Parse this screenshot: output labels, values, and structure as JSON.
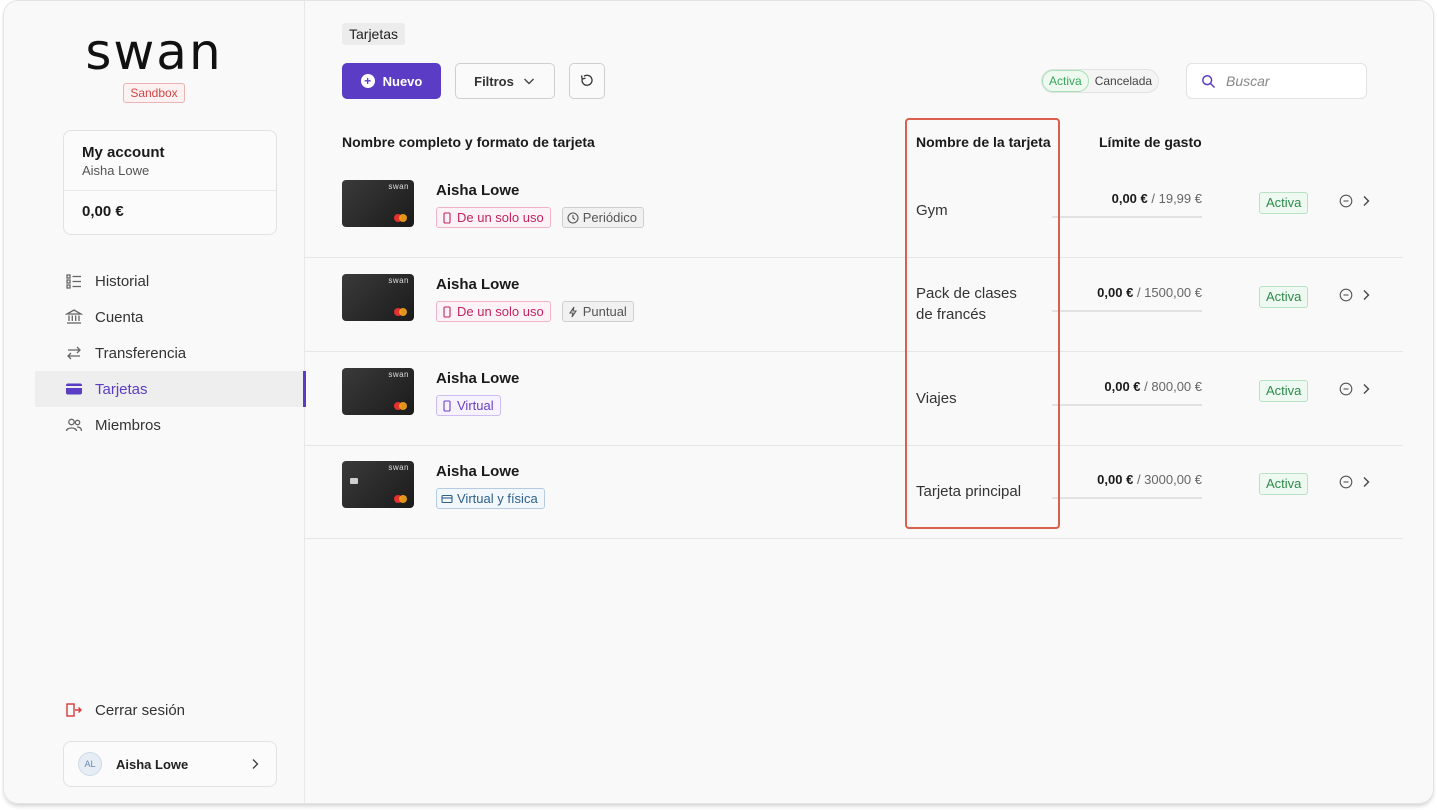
{
  "sidebar": {
    "logo": "swan",
    "env_badge": "Sandbox",
    "account": {
      "title": "My account",
      "owner": "Aisha Lowe",
      "balance": "0,00 €"
    },
    "nav": [
      {
        "label": "Historial",
        "icon": "list-icon"
      },
      {
        "label": "Cuenta",
        "icon": "bank-icon"
      },
      {
        "label": "Transferencia",
        "icon": "transfer-icon"
      },
      {
        "label": "Tarjetas",
        "icon": "card-icon",
        "active": true
      },
      {
        "label": "Miembros",
        "icon": "users-icon"
      }
    ],
    "logout_label": "Cerrar sesión",
    "user": {
      "initials": "AL",
      "name": "Aisha Lowe"
    }
  },
  "header": {
    "breadcrumb": "Tarjetas",
    "new_button": "Nuevo",
    "filter_button": "Filtros",
    "status_toggle": {
      "active": "Activa",
      "canceled": "Cancelada"
    },
    "search_placeholder": "Buscar"
  },
  "table": {
    "columns": {
      "name_format": "Nombre completo y formato de tarjeta",
      "card_name": "Nombre de la tarjeta",
      "spending_limit": "Límite de gasto"
    },
    "rows": [
      {
        "holder": "Aisha Lowe",
        "card_brand": "swan",
        "tags": [
          {
            "label": "De un solo uso",
            "icon": "phone-icon",
            "style": "pink"
          },
          {
            "label": "Periódico",
            "icon": "clock-icon",
            "style": "gray"
          }
        ],
        "card_name_lines": [
          "Gym"
        ],
        "spent": "0,00 €",
        "limit": "/ 19,99 €",
        "status": "Activa"
      },
      {
        "holder": "Aisha Lowe",
        "card_brand": "swan",
        "tags": [
          {
            "label": "De un solo uso",
            "icon": "phone-icon",
            "style": "pink"
          },
          {
            "label": "Puntual",
            "icon": "bolt-icon",
            "style": "gray"
          }
        ],
        "card_name_lines": [
          "Pack de clases",
          "de francés"
        ],
        "spent": "0,00 €",
        "limit": "/ 1500,00 €",
        "status": "Activa"
      },
      {
        "holder": "Aisha Lowe",
        "card_brand": "swan",
        "tags": [
          {
            "label": "Virtual",
            "icon": "phone-icon",
            "style": "purple"
          }
        ],
        "card_name_lines": [
          "Viajes"
        ],
        "spent": "0,00 €",
        "limit": "/ 800,00 €",
        "status": "Activa"
      },
      {
        "holder": "Aisha Lowe",
        "card_brand": "swan",
        "tags": [
          {
            "label": "Virtual y física",
            "icon": "card-icon",
            "style": "blue"
          }
        ],
        "card_name_lines": [
          "Tarjeta principal"
        ],
        "spent": "0,00 €",
        "limit": "/ 3000,00 €",
        "status": "Activa"
      }
    ]
  },
  "colors": {
    "accent": "#5b3cc4",
    "active_status": "#2e8b4a",
    "highlight_border": "#d9604c",
    "logout_icon": "#d83a3a"
  }
}
